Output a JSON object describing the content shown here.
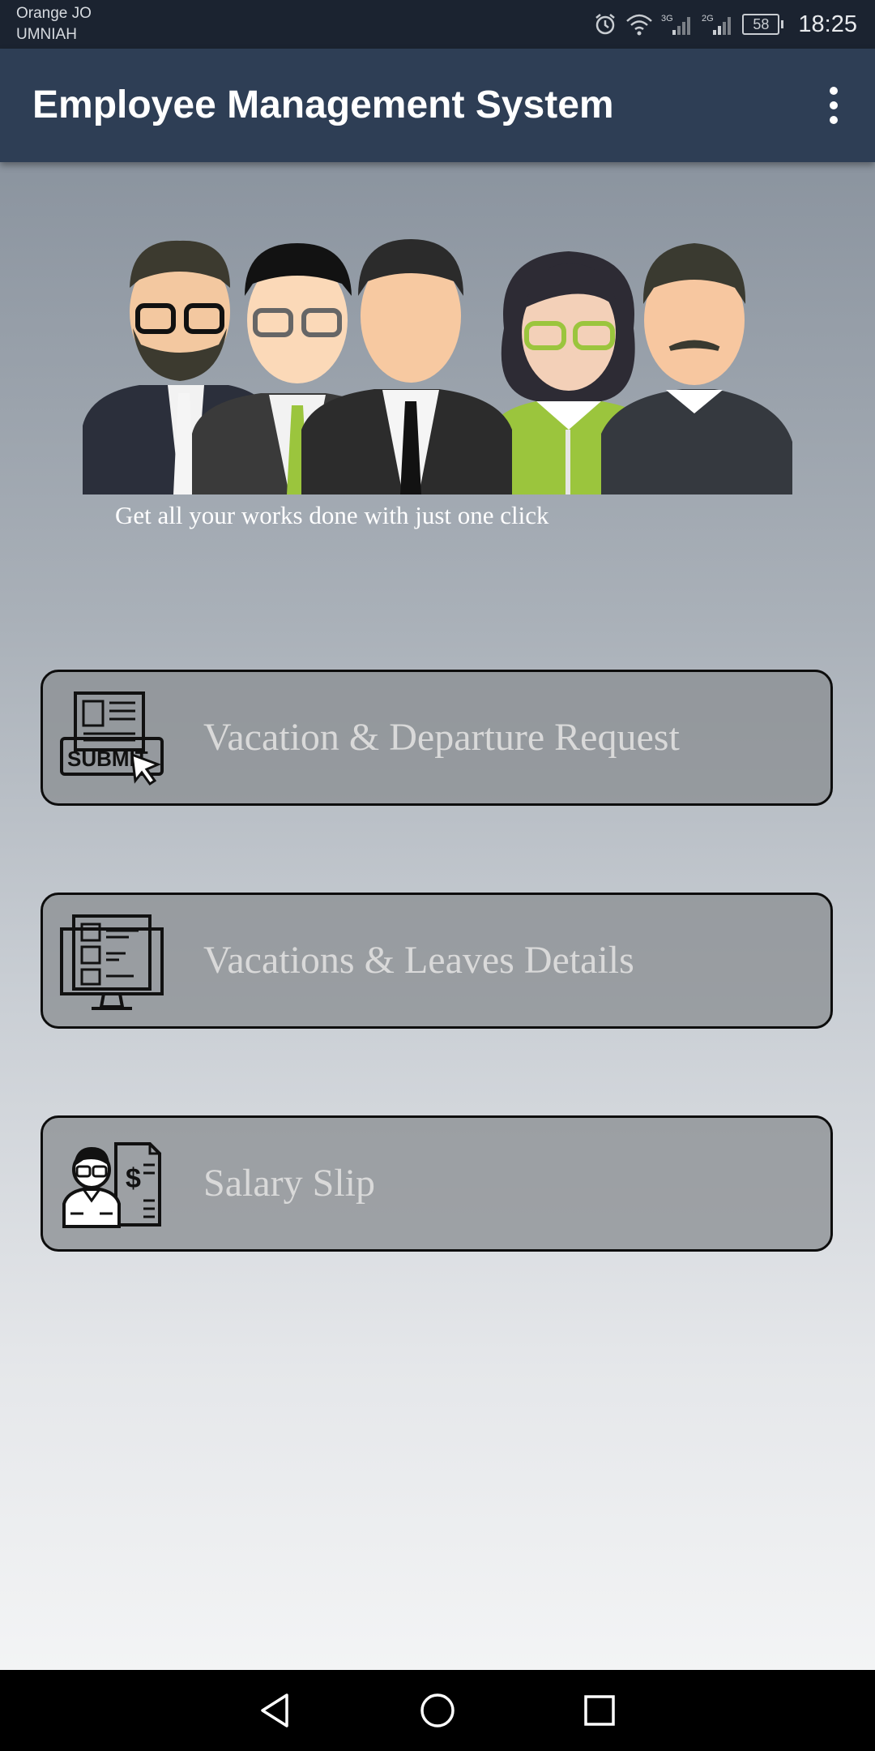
{
  "status_bar": {
    "carrier_1": "Orange JO",
    "carrier_2": "UMNIAH",
    "network_1": "3G",
    "network_2": "2G",
    "battery": "58",
    "time": "18:25"
  },
  "app_bar": {
    "title": "Employee Management System",
    "overflow_icon": "more-vert-icon"
  },
  "hero": {
    "image": "employee-group-illustration",
    "tagline": "Get all your works done with just one click"
  },
  "menu": [
    {
      "label": "Vacation & Departure Request",
      "icon": "submit-form-icon",
      "icon_text": "SUBMIT"
    },
    {
      "label": "Vacations & Leaves Details",
      "icon": "monitor-list-icon"
    },
    {
      "label": "Salary Slip",
      "icon": "employee-salary-icon",
      "icon_text": "$"
    }
  ],
  "nav_bar": {
    "back": "back-icon",
    "home": "home-icon",
    "recents": "recents-icon"
  },
  "colors": {
    "status_bar": "#1b2330",
    "app_bar": "#2e3e55",
    "accent_green": "#9bc53d",
    "button_fill": "#8c8f93"
  }
}
